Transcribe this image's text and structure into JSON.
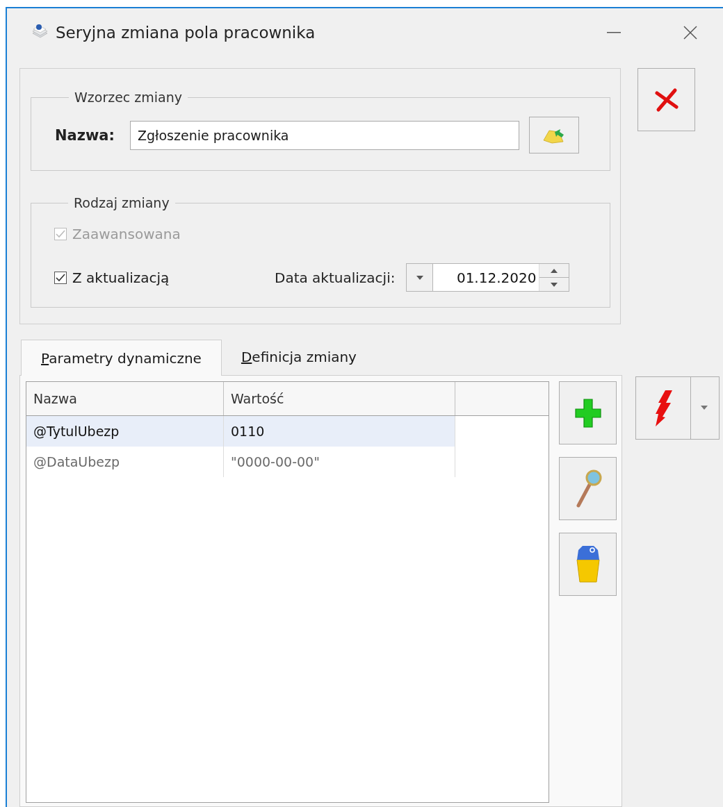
{
  "window": {
    "title": "Seryjna zmiana pola pracownika"
  },
  "template": {
    "legend": "Wzorzec zmiany",
    "label": "Nazwa:",
    "value": "Zgłoszenie pracownika"
  },
  "change_type": {
    "legend": "Rodzaj zmiany",
    "options": [
      {
        "label": "Zaawansowana",
        "checked": true,
        "disabled": true
      },
      {
        "label": "Z aktualizacją",
        "checked": true,
        "disabled": false
      }
    ],
    "date_label": "Data aktualizacji:",
    "date_value": "01.12.2020"
  },
  "tabs": [
    {
      "label": "Parametry dynamiczne",
      "selected": true,
      "mnemonic": true
    },
    {
      "label": "Definicja zmiany",
      "selected": false,
      "mnemonic": true
    }
  ],
  "table": {
    "columns": [
      "Nazwa",
      "Wartość"
    ],
    "rows": [
      {
        "cells": [
          "@TytulUbezp",
          "0110"
        ],
        "selected": true
      },
      {
        "cells": [
          "@DataUbezp",
          "\"0000-00-00\""
        ],
        "selected": false
      }
    ]
  }
}
